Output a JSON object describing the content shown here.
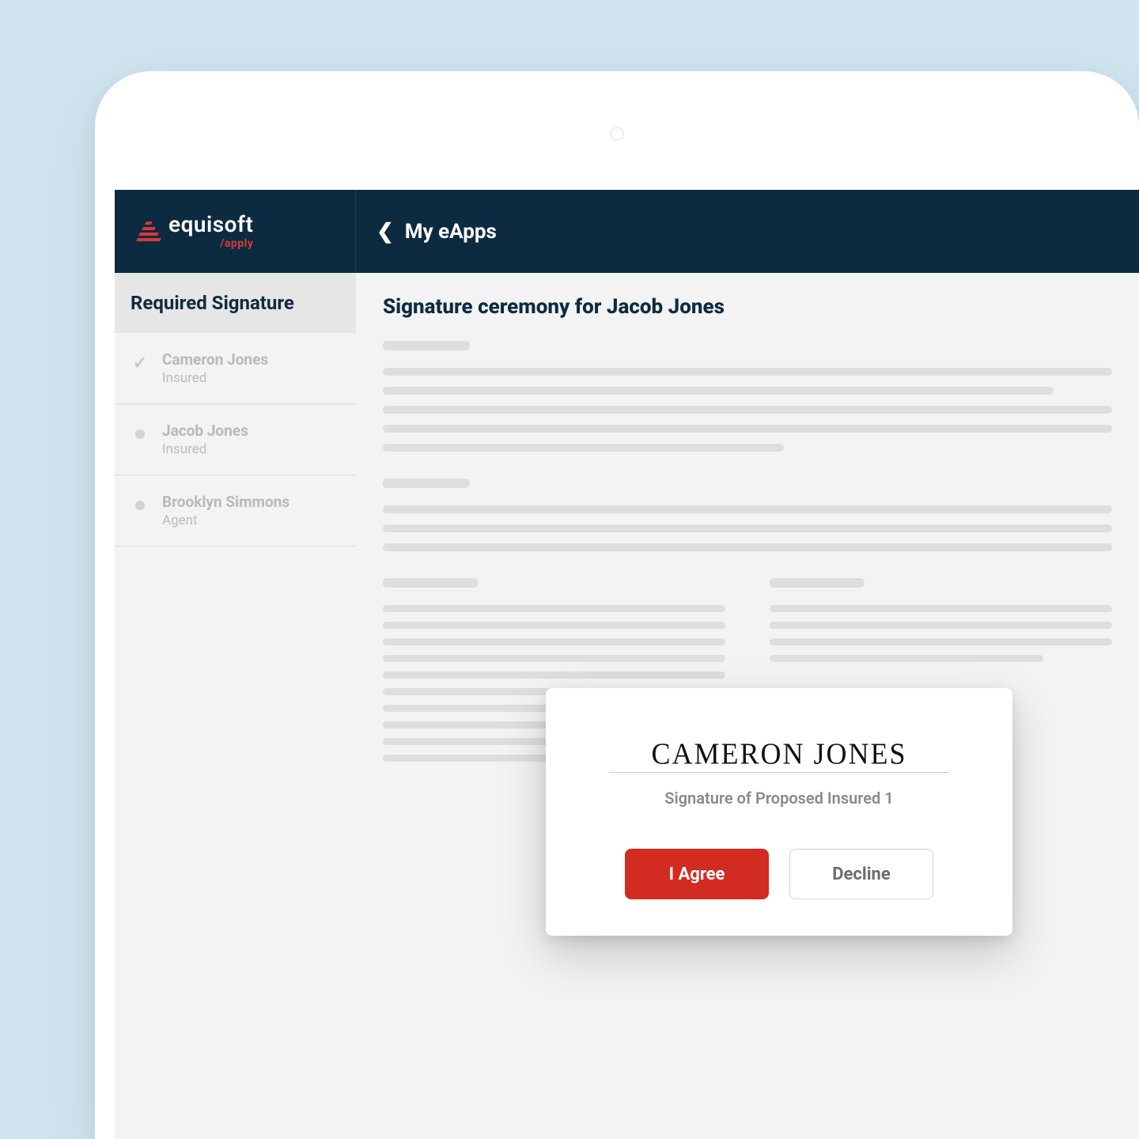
{
  "brand": {
    "name": "equisoft",
    "product": "/apply"
  },
  "header": {
    "back_label": "My eApps"
  },
  "sidebar": {
    "title": "Required Signature",
    "items": [
      {
        "name": "Cameron Jones",
        "role": "Insured",
        "status": "done"
      },
      {
        "name": "Jacob Jones",
        "role": "Insured",
        "status": "pending"
      },
      {
        "name": "Brooklyn Simmons",
        "role": "Agent",
        "status": "pending"
      }
    ]
  },
  "main": {
    "title": "Signature ceremony for Jacob Jones"
  },
  "signature_card": {
    "signer_display": "CAMERON JONES",
    "caption": "Signature of Proposed Insured 1",
    "agree_label": "I Agree",
    "decline_label": "Decline"
  }
}
